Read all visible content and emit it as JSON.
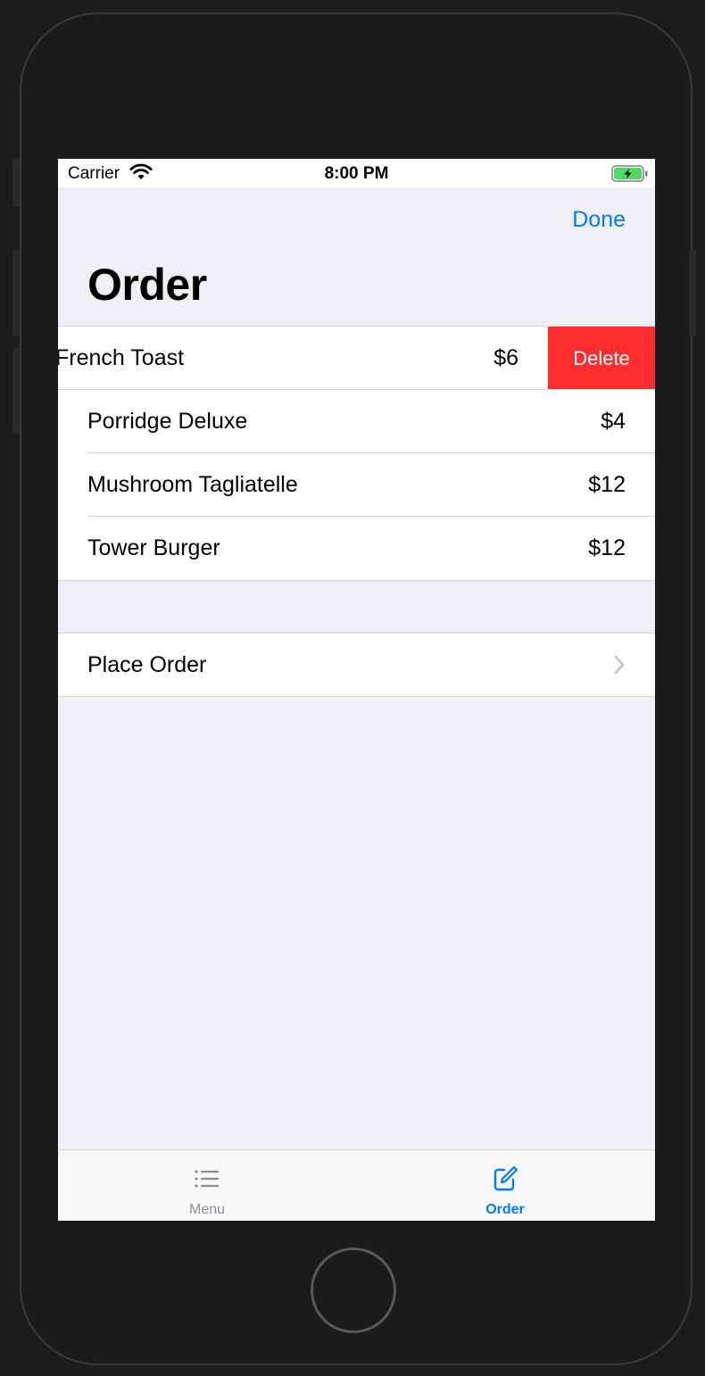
{
  "status_bar": {
    "carrier": "Carrier",
    "time": "8:00 PM"
  },
  "nav": {
    "done_label": "Done",
    "title": "Order"
  },
  "order_items": [
    {
      "name": "French Toast",
      "price": "$6"
    },
    {
      "name": "Porridge Deluxe",
      "price": "$4"
    },
    {
      "name": "Mushroom Tagliatelle",
      "price": "$12"
    },
    {
      "name": "Tower Burger",
      "price": "$12"
    }
  ],
  "swipe_action": {
    "delete_label": "Delete"
  },
  "place_order": {
    "label": "Place Order"
  },
  "tabs": [
    {
      "label": "Menu",
      "icon": "list-icon",
      "selected": false
    },
    {
      "label": "Order",
      "icon": "compose-icon",
      "selected": true
    }
  ],
  "colors": {
    "accent": "#007aff",
    "destructive": "#ff2d30",
    "background": "#efeff4",
    "battery_charging": "#4cd964"
  }
}
